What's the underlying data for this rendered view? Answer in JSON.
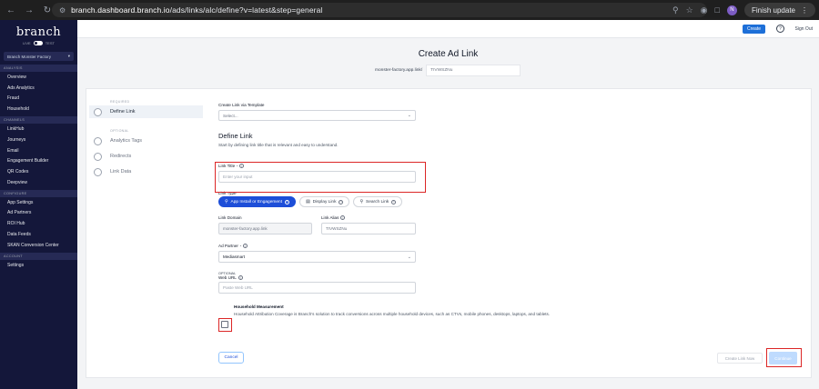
{
  "browser": {
    "url_host": "branch.dashboard.branch.io",
    "url_path": "/ads/links/alc/define?v=latest&step=general",
    "profile_initial": "N",
    "finish_update_label": "Finish update"
  },
  "sidebar": {
    "logo": "branch",
    "live_label": "LIVE",
    "test_label": "TEST",
    "org_name": "Branch Monster Factory",
    "sections": [
      {
        "header": "ANALYSIS",
        "items": [
          "Overview",
          "Ads Analytics",
          "Fraud",
          "Household"
        ]
      },
      {
        "header": "CHANNELS",
        "items": [
          "LinkHub",
          "Journeys",
          "Email",
          "Engagement Builder",
          "QR Codes",
          "Deepview"
        ]
      },
      {
        "header": "CONFIGURE",
        "items": [
          "App Settings",
          "Ad Partners",
          "ROI Hub",
          "Data Feeds",
          "SKAN Conversion Center"
        ]
      },
      {
        "header": "ACCOUNT",
        "items": [
          "Settings"
        ]
      }
    ]
  },
  "topbar": {
    "create_label": "Create",
    "help_icon": "?",
    "signout_label": "Sign Out"
  },
  "page": {
    "title": "Create Ad Link",
    "domain_label": "monster-factory.app.link/",
    "alias_value": "TIVWSZNu"
  },
  "steps": {
    "required_label": "REQUIRED",
    "optional_label": "OPTIONAL",
    "required_items": [
      "Define Link"
    ],
    "optional_items": [
      "Analytics Tags",
      "Redirects",
      "Link Data"
    ]
  },
  "form": {
    "template_label": "Create Link via Template",
    "template_placeholder": "Select...",
    "section_title": "Define Link",
    "section_desc": "Start by defining link title that is relevant and easy to understand.",
    "link_title_label": "Link Title",
    "link_title_placeholder": "Enter your input",
    "link_type_label": "Link Type",
    "link_types": [
      "App Install or Engagement",
      "Display Link",
      "Search Link"
    ],
    "link_domain_label": "Link Domain",
    "link_domain_value": "monster-factory.app.link",
    "link_alias_label": "Link Alias",
    "link_alias_value": "TIVWSZNu",
    "ad_partner_label": "Ad Partner",
    "ad_partner_value": "Mediasmart",
    "optional_label": "OPTIONAL",
    "web_url_label": "Web URL",
    "web_url_placeholder": "Paste Web URL",
    "household_title": "Household Measurement",
    "household_desc": "Household Attribution Coverage is Branch's solution to track conversions across multiple household devices, such as CTVs, mobile phones, desktops, laptops, and tablets."
  },
  "footer": {
    "cancel_label": "Cancel",
    "create_now_label": "Create Link Now",
    "continue_label": "Continue"
  }
}
